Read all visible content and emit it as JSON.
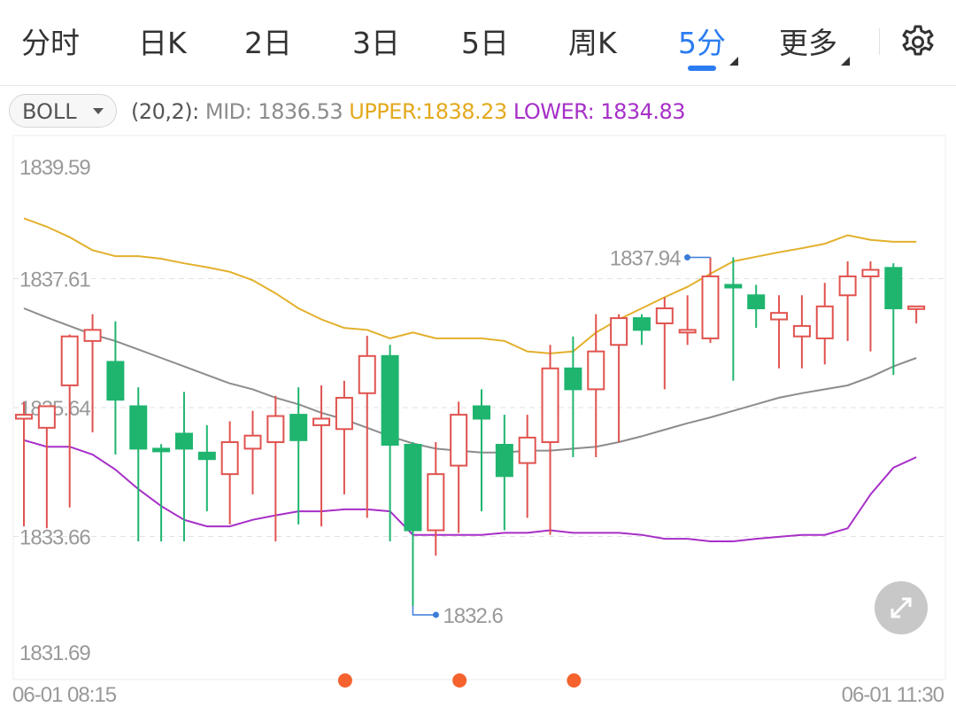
{
  "tabs": [
    {
      "label": "分时",
      "active": false,
      "has_menu": false
    },
    {
      "label": "日K",
      "active": false,
      "has_menu": false
    },
    {
      "label": "2日",
      "active": false,
      "has_menu": false
    },
    {
      "label": "3日",
      "active": false,
      "has_menu": false
    },
    {
      "label": "5日",
      "active": false,
      "has_menu": false
    },
    {
      "label": "周K",
      "active": false,
      "has_menu": false
    },
    {
      "label": "5分",
      "active": true,
      "has_menu": true
    },
    {
      "label": "更多",
      "active": false,
      "has_menu": true
    }
  ],
  "settings_icon": "gear-icon",
  "indicator": {
    "name": "BOLL",
    "params": "(20,2):",
    "mid_label": "MID: 1836.53",
    "upper_label": "UPPER:1838.23",
    "lower_label": "LOWER: 1834.83"
  },
  "colors": {
    "up": "#e0534f",
    "down": "#1fb56f",
    "mid": "#8c8c8c",
    "upper": "#e3b02c",
    "lower": "#a62fc7",
    "active_tab": "#2b7cf0",
    "markers": "#f5622d"
  },
  "expand_icon": "expand-icon",
  "chart_data": {
    "type": "candlestick",
    "y_ticks": [
      "1839.59",
      "1837.61",
      "1835.64",
      "1833.66",
      "1831.69"
    ],
    "ylim": [
      1831.69,
      1839.59
    ],
    "x_start_label": "06-01 08:15",
    "x_end_label": "06-01 11:30",
    "max_label": "1837.94",
    "min_label": "1832.6",
    "max_value": 1837.94,
    "min_value": 1832.6,
    "candles": [
      {
        "o": 1835.47,
        "h": 1835.73,
        "l": 1833.82,
        "c": 1835.53
      },
      {
        "o": 1835.33,
        "h": 1835.66,
        "l": 1833.79,
        "c": 1835.66
      },
      {
        "o": 1835.98,
        "h": 1836.76,
        "l": 1834.11,
        "c": 1836.73
      },
      {
        "o": 1836.66,
        "h": 1837.07,
        "l": 1835.26,
        "c": 1836.83
      },
      {
        "o": 1836.34,
        "h": 1836.96,
        "l": 1834.92,
        "c": 1835.76
      },
      {
        "o": 1835.66,
        "h": 1835.95,
        "l": 1833.59,
        "c": 1835.01
      },
      {
        "o": 1835.01,
        "h": 1835.08,
        "l": 1833.59,
        "c": 1834.98
      },
      {
        "o": 1835.24,
        "h": 1835.88,
        "l": 1833.59,
        "c": 1835.01
      },
      {
        "o": 1834.95,
        "h": 1835.37,
        "l": 1834.05,
        "c": 1834.85
      },
      {
        "o": 1834.62,
        "h": 1835.43,
        "l": 1833.85,
        "c": 1835.11
      },
      {
        "o": 1835.01,
        "h": 1835.59,
        "l": 1834.31,
        "c": 1835.21
      },
      {
        "o": 1835.11,
        "h": 1835.82,
        "l": 1833.59,
        "c": 1835.51
      },
      {
        "o": 1835.53,
        "h": 1835.95,
        "l": 1833.85,
        "c": 1835.14
      },
      {
        "o": 1835.37,
        "h": 1835.98,
        "l": 1833.82,
        "c": 1835.47
      },
      {
        "o": 1835.31,
        "h": 1836.05,
        "l": 1834.31,
        "c": 1835.79
      },
      {
        "o": 1835.86,
        "h": 1836.74,
        "l": 1833.95,
        "c": 1836.43
      },
      {
        "o": 1836.43,
        "h": 1836.6,
        "l": 1833.59,
        "c": 1835.07
      },
      {
        "o": 1835.07,
        "h": 1835.11,
        "l": 1832.6,
        "c": 1833.76
      },
      {
        "o": 1833.76,
        "h": 1835.11,
        "l": 1833.37,
        "c": 1834.62
      },
      {
        "o": 1834.75,
        "h": 1835.73,
        "l": 1833.72,
        "c": 1835.53
      },
      {
        "o": 1835.66,
        "h": 1835.92,
        "l": 1834.05,
        "c": 1835.47
      },
      {
        "o": 1835.07,
        "h": 1835.53,
        "l": 1833.76,
        "c": 1834.59
      },
      {
        "o": 1834.79,
        "h": 1835.53,
        "l": 1833.95,
        "c": 1835.18
      },
      {
        "o": 1835.11,
        "h": 1836.6,
        "l": 1833.69,
        "c": 1836.24
      },
      {
        "o": 1836.24,
        "h": 1836.73,
        "l": 1834.88,
        "c": 1835.92
      },
      {
        "o": 1835.92,
        "h": 1837.07,
        "l": 1834.88,
        "c": 1836.5
      },
      {
        "o": 1836.6,
        "h": 1837.07,
        "l": 1835.11,
        "c": 1837.01
      },
      {
        "o": 1837.01,
        "h": 1837.07,
        "l": 1836.6,
        "c": 1836.83
      },
      {
        "o": 1836.93,
        "h": 1837.33,
        "l": 1835.92,
        "c": 1837.16
      },
      {
        "o": 1836.83,
        "h": 1837.36,
        "l": 1836.6,
        "c": 1836.83
      },
      {
        "o": 1836.7,
        "h": 1837.94,
        "l": 1836.63,
        "c": 1837.65
      },
      {
        "o": 1837.52,
        "h": 1837.94,
        "l": 1836.05,
        "c": 1837.49
      },
      {
        "o": 1837.36,
        "h": 1837.52,
        "l": 1836.86,
        "c": 1837.16
      },
      {
        "o": 1836.99,
        "h": 1837.36,
        "l": 1836.24,
        "c": 1837.09
      },
      {
        "o": 1836.73,
        "h": 1837.36,
        "l": 1836.24,
        "c": 1836.89
      },
      {
        "o": 1836.7,
        "h": 1837.55,
        "l": 1836.3,
        "c": 1837.19
      },
      {
        "o": 1837.36,
        "h": 1837.88,
        "l": 1836.66,
        "c": 1837.65
      },
      {
        "o": 1837.65,
        "h": 1837.88,
        "l": 1836.5,
        "c": 1837.75
      },
      {
        "o": 1837.78,
        "h": 1837.85,
        "l": 1836.14,
        "c": 1837.16
      },
      {
        "o": 1837.19,
        "h": 1837.19,
        "l": 1836.93,
        "c": 1837.19
      }
    ],
    "mid": [
      1837.16,
      1837.02,
      1836.89,
      1836.76,
      1836.66,
      1836.53,
      1836.4,
      1836.27,
      1836.14,
      1836.01,
      1835.92,
      1835.79,
      1835.69,
      1835.56,
      1835.46,
      1835.33,
      1835.2,
      1835.09,
      1835.01,
      1834.98,
      1834.95,
      1834.95,
      1834.98,
      1834.98,
      1835.01,
      1835.04,
      1835.11,
      1835.2,
      1835.3,
      1835.4,
      1835.49,
      1835.59,
      1835.69,
      1835.79,
      1835.86,
      1835.92,
      1835.98,
      1836.11,
      1836.27,
      1836.4
    ],
    "upper": [
      1838.54,
      1838.41,
      1838.25,
      1838.05,
      1837.96,
      1837.96,
      1837.92,
      1837.85,
      1837.79,
      1837.72,
      1837.59,
      1837.39,
      1837.16,
      1836.99,
      1836.86,
      1836.83,
      1836.7,
      1836.79,
      1836.7,
      1836.7,
      1836.7,
      1836.66,
      1836.5,
      1836.47,
      1836.5,
      1836.79,
      1836.99,
      1837.16,
      1837.33,
      1837.49,
      1837.69,
      1837.88,
      1837.95,
      1838.02,
      1838.08,
      1838.15,
      1838.28,
      1838.21,
      1838.18,
      1838.18
    ],
    "lower": [
      1835.14,
      1835.04,
      1835.04,
      1834.92,
      1834.69,
      1834.39,
      1834.13,
      1833.92,
      1833.82,
      1833.82,
      1833.92,
      1833.99,
      1834.05,
      1834.05,
      1834.08,
      1834.08,
      1834.05,
      1833.69,
      1833.69,
      1833.69,
      1833.69,
      1833.72,
      1833.72,
      1833.76,
      1833.72,
      1833.72,
      1833.72,
      1833.69,
      1833.63,
      1833.63,
      1833.59,
      1833.59,
      1833.63,
      1833.66,
      1833.69,
      1833.69,
      1833.79,
      1834.31,
      1834.72,
      1834.88
    ],
    "event_markers_at_index": [
      14,
      19,
      24
    ],
    "grid": true
  }
}
